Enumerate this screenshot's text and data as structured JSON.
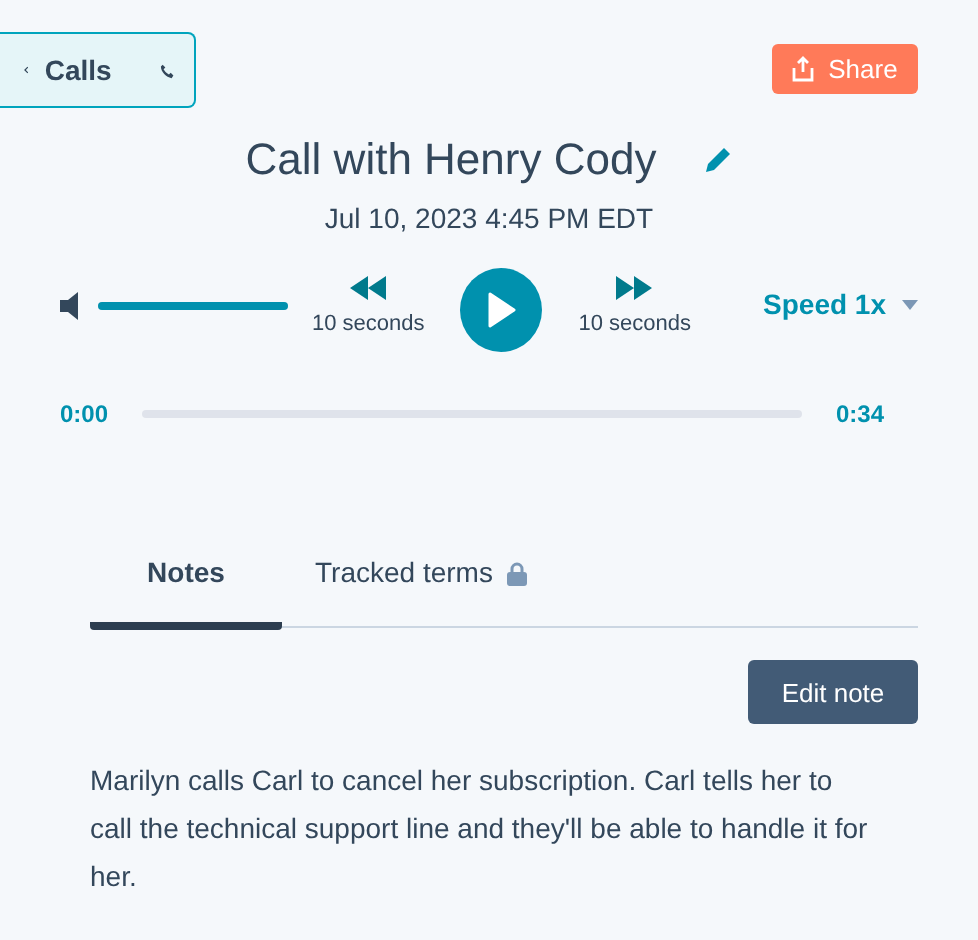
{
  "back_button": {
    "label": "Calls"
  },
  "share_button": {
    "label": "Share"
  },
  "title": "Call with Henry Cody",
  "date": "Jul 10, 2023 4:45 PM EDT",
  "player": {
    "volume": {
      "level": 1.0
    },
    "rewind": {
      "label": "10 seconds"
    },
    "playing": false,
    "forward": {
      "label": "10 seconds"
    },
    "speed": "Speed 1x",
    "elapsed": "0:00",
    "progress": {
      "level": 0.0
    },
    "duration": "0:34"
  },
  "tabs": [
    {
      "label": "Notes",
      "selected": true,
      "locked": false
    },
    {
      "label": "Tracked terms",
      "selected": false,
      "locked": true
    }
  ],
  "edit_button": {
    "label": "Edit note"
  },
  "note": "Marilyn calls Carl to cancel her subscription. Carl tells her to call the technical support line and they'll be able to handle it for her."
}
